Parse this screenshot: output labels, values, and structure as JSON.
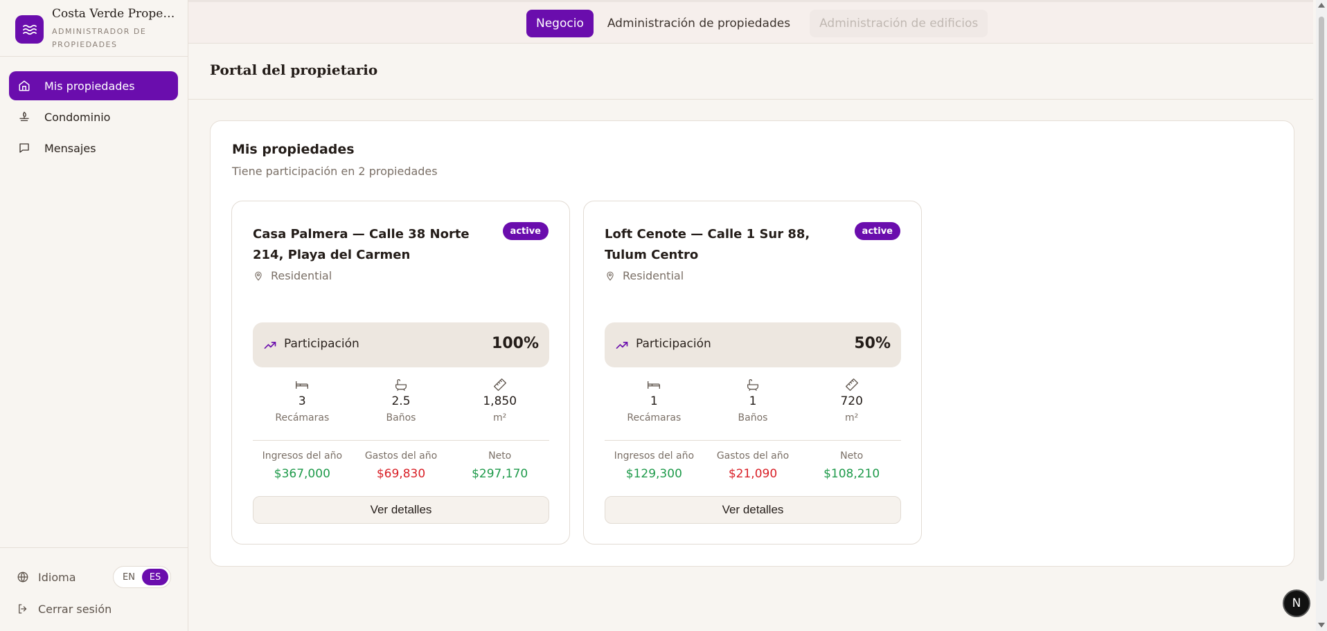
{
  "brand": {
    "name": "Costa Verde Properties",
    "subtitle": "Administrador de propiedades",
    "icon": "waves-icon"
  },
  "sidebar": {
    "items": [
      {
        "label": "Mis propiedades",
        "icon": "home-icon",
        "active": true
      },
      {
        "label": "Condominio",
        "icon": "building-icon",
        "active": false
      },
      {
        "label": "Mensajes",
        "icon": "message-icon",
        "active": false
      }
    ],
    "language_label": "Idioma",
    "languages": [
      "EN",
      "ES"
    ],
    "selected_language": "ES",
    "logout_label": "Cerrar sesión"
  },
  "topbar": {
    "tabs": [
      {
        "label": "Negocio",
        "state": "active"
      },
      {
        "label": "Administración de propiedades",
        "state": "normal"
      },
      {
        "label": "Administración de edificios",
        "state": "disabled"
      }
    ]
  },
  "page": {
    "title": "Portal del propietario"
  },
  "panel": {
    "title": "Mis propiedades",
    "subtitle": "Tiene participación en 2 propiedades"
  },
  "cards": [
    {
      "title": "Casa Palmera — Calle 38 Norte 214, Playa del Carmen",
      "status": "active",
      "type": "Residential",
      "participation_label": "Participación",
      "participation": "100%",
      "stats": [
        {
          "value": "3",
          "label": "Recámaras",
          "icon": "bed-icon"
        },
        {
          "value": "2.5",
          "label": "Baños",
          "icon": "bath-icon"
        },
        {
          "value": "1,850",
          "label": "m²",
          "icon": "ruler-icon"
        }
      ],
      "finance": [
        {
          "label": "Ingresos del año",
          "value": "$367,000",
          "tone": "green"
        },
        {
          "label": "Gastos del año",
          "value": "$69,830",
          "tone": "red"
        },
        {
          "label": "Neto",
          "value": "$297,170",
          "tone": "green"
        }
      ],
      "button": "Ver detalles"
    },
    {
      "title": "Loft Cenote — Calle 1 Sur 88, Tulum Centro",
      "status": "active",
      "type": "Residential",
      "participation_label": "Participación",
      "participation": "50%",
      "stats": [
        {
          "value": "1",
          "label": "Recámaras",
          "icon": "bed-icon"
        },
        {
          "value": "1",
          "label": "Baños",
          "icon": "bath-icon"
        },
        {
          "value": "720",
          "label": "m²",
          "icon": "ruler-icon"
        }
      ],
      "finance": [
        {
          "label": "Ingresos del año",
          "value": "$129,300",
          "tone": "green"
        },
        {
          "label": "Gastos del año",
          "value": "$21,090",
          "tone": "red"
        },
        {
          "label": "Neto",
          "value": "$108,210",
          "tone": "green"
        }
      ],
      "button": "Ver detalles"
    }
  ],
  "overlay": {
    "badge_letter": "N"
  },
  "colors": {
    "accent": "#6a0dad",
    "positive": "#1e9a4a",
    "negative": "#d91f26",
    "background": "#f8f5f1"
  }
}
